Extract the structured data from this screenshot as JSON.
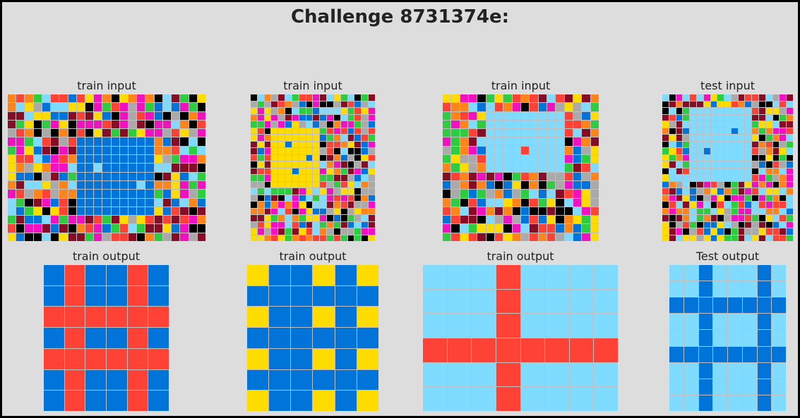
{
  "title": "Challenge 8731374e:",
  "palette": [
    "#000000",
    "#0074D9",
    "#FF4136",
    "#2ECC40",
    "#FFDC00",
    "#AAAAAA",
    "#F012BE",
    "#FF851B",
    "#7FDBFF",
    "#870C25"
  ],
  "panels": [
    {
      "label": "train input",
      "rows": 17,
      "cols": 23,
      "noise": [
        0,
        1,
        2,
        3,
        4,
        5,
        6,
        7,
        8,
        9
      ],
      "rect": {
        "r0": 5,
        "c0": 8,
        "r1": 13,
        "c1": 16,
        "color": 1
      },
      "dots": [
        [
          8,
          10,
          8
        ],
        [
          10,
          15,
          8
        ]
      ]
    },
    {
      "label": "train input",
      "rows": 22,
      "cols": 18,
      "noise": [
        0,
        1,
        2,
        3,
        4,
        5,
        6,
        7,
        8,
        9
      ],
      "rect": {
        "r0": 5,
        "c0": 3,
        "r1": 13,
        "c1": 9,
        "color": 4
      },
      "dots": [
        [
          7,
          5,
          1
        ],
        [
          9,
          8,
          1
        ],
        [
          11,
          6,
          1
        ]
      ]
    },
    {
      "label": "train input",
      "rows": 17,
      "cols": 18,
      "noise": [
        0,
        1,
        2,
        3,
        4,
        5,
        6,
        7,
        8,
        9
      ],
      "rect": {
        "r0": 2,
        "c0": 5,
        "r1": 8,
        "c1": 13,
        "color": 8
      },
      "dots": [
        [
          6,
          9,
          2
        ]
      ]
    },
    {
      "label": "test input",
      "rows": 22,
      "cols": 19,
      "noise": [
        0,
        1,
        2,
        3,
        4,
        5,
        6,
        7,
        8,
        9
      ],
      "rect": {
        "r0": 2,
        "c0": 4,
        "r1": 12,
        "c1": 12,
        "color": 8
      },
      "dots": [
        [
          5,
          10,
          1
        ],
        [
          8,
          6,
          1
        ]
      ]
    },
    {
      "label": "train output",
      "rows": 7,
      "cols": 6,
      "bg": 1,
      "line": 2,
      "lineRows": [
        2,
        4
      ],
      "lineCols": [
        1,
        4
      ]
    },
    {
      "label": "train output",
      "rows": 7,
      "cols": 6,
      "bg": 4,
      "line": 1,
      "lineRows": [
        1,
        3,
        5
      ],
      "lineCols": [
        1,
        2,
        4
      ]
    },
    {
      "label": "train output",
      "rows": 6,
      "cols": 8,
      "bg": 8,
      "line": 2,
      "lineRows": [
        3
      ],
      "lineCols": [
        3
      ]
    },
    {
      "label": "Test output",
      "rows": 9,
      "cols": 8,
      "bg": 8,
      "line": 1,
      "lineRows": [
        2,
        5
      ],
      "lineCols": [
        2,
        6
      ]
    }
  ]
}
